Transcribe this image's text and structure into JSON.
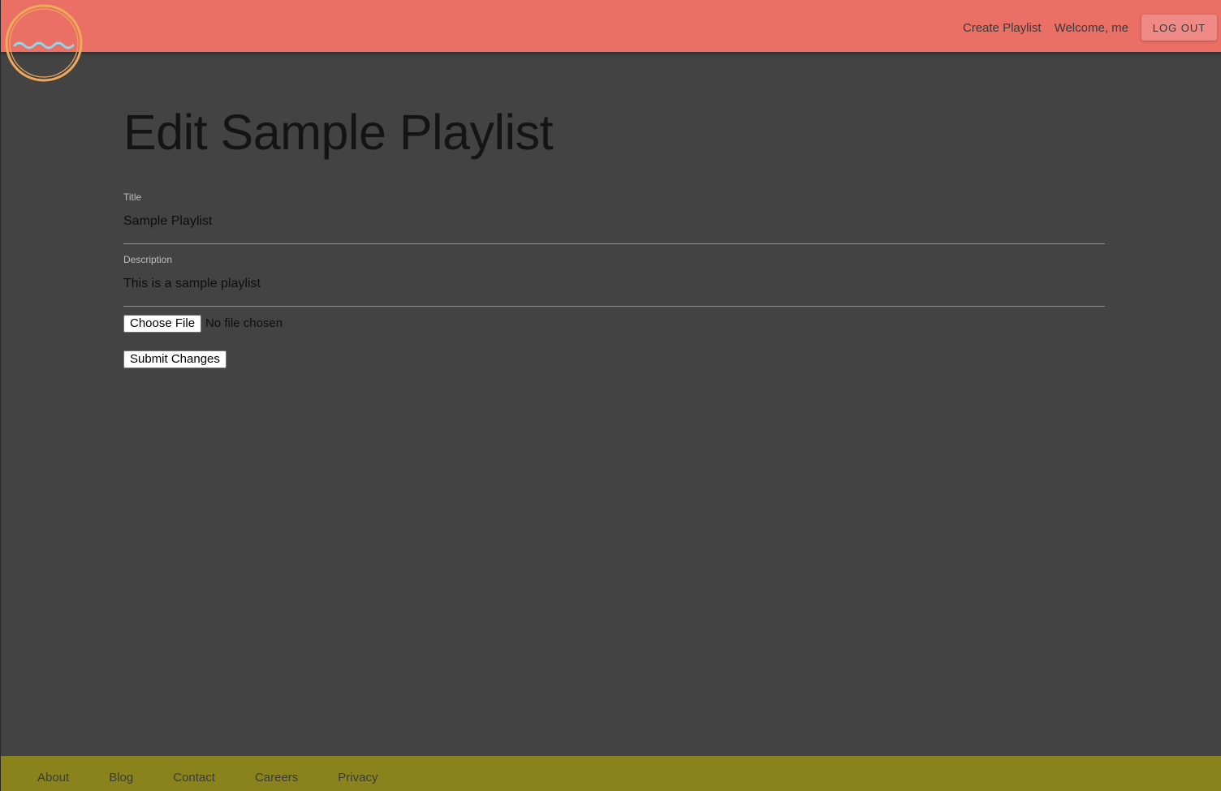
{
  "header": {
    "logo_icon": "wave-circle-logo-icon",
    "nav": {
      "create_playlist": "Create Playlist",
      "welcome": "Welcome, me",
      "logout": "LOG OUT"
    }
  },
  "main": {
    "page_title": "Edit Sample Playlist",
    "form": {
      "title_label": "Title",
      "title_value": "Sample Playlist",
      "description_label": "Description",
      "description_value": "This is a sample playlist",
      "file_button": "Choose File",
      "file_status": "No file chosen",
      "submit_label": "Submit Changes"
    }
  },
  "footer": {
    "links": [
      "About",
      "Blog",
      "Contact",
      "Careers",
      "Privacy"
    ]
  },
  "colors": {
    "header_bg": "#ea6f65",
    "page_bg": "#434343",
    "footer_bg": "#8a831c",
    "logo_ring": "#f0a95a",
    "logo_wave": "#8fd6e8"
  }
}
